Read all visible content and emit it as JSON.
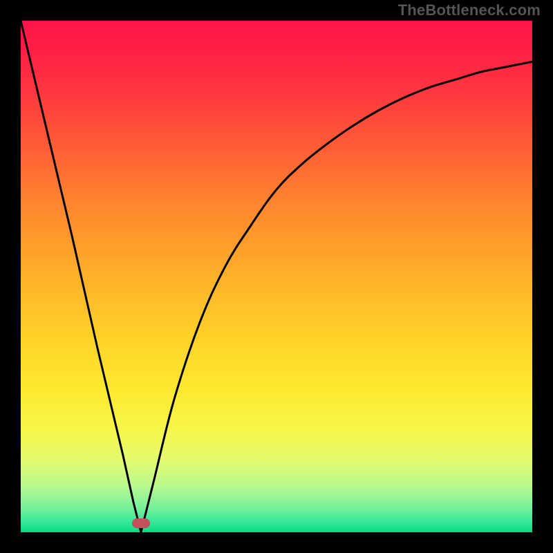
{
  "attribution": "TheBottleneck.com",
  "colors": {
    "frame_bg": "#000000",
    "curve_stroke": "#000000",
    "marker_fill": "#c4505c",
    "attribution_text": "#555555"
  },
  "plot": {
    "x_range": [
      0,
      100
    ],
    "y_range": [
      0,
      100
    ]
  },
  "marker": {
    "x_pct": 23.5,
    "y_from_bottom_pct": 1.8
  },
  "chart_data": {
    "type": "line",
    "title": "",
    "xlabel": "",
    "ylabel": "",
    "xlim": [
      0,
      100
    ],
    "ylim": [
      0,
      100
    ],
    "series": [
      {
        "name": "left-branch",
        "x": [
          0,
          5,
          10,
          15,
          20,
          22,
          23.5
        ],
        "values": [
          100,
          79,
          58,
          36,
          15,
          6,
          0
        ]
      },
      {
        "name": "right-branch",
        "x": [
          23.5,
          26,
          30,
          35,
          40,
          45,
          50,
          55,
          60,
          65,
          70,
          75,
          80,
          85,
          90,
          95,
          100
        ],
        "values": [
          0,
          10,
          26,
          41,
          52,
          60,
          67,
          72,
          76,
          79.5,
          82.5,
          85,
          87,
          88.5,
          90,
          91,
          92
        ]
      }
    ],
    "annotations": [
      {
        "type": "marker",
        "x": 23.5,
        "y": 0,
        "label": ""
      }
    ],
    "background": "vertical-gradient red→orange→yellow→green"
  }
}
